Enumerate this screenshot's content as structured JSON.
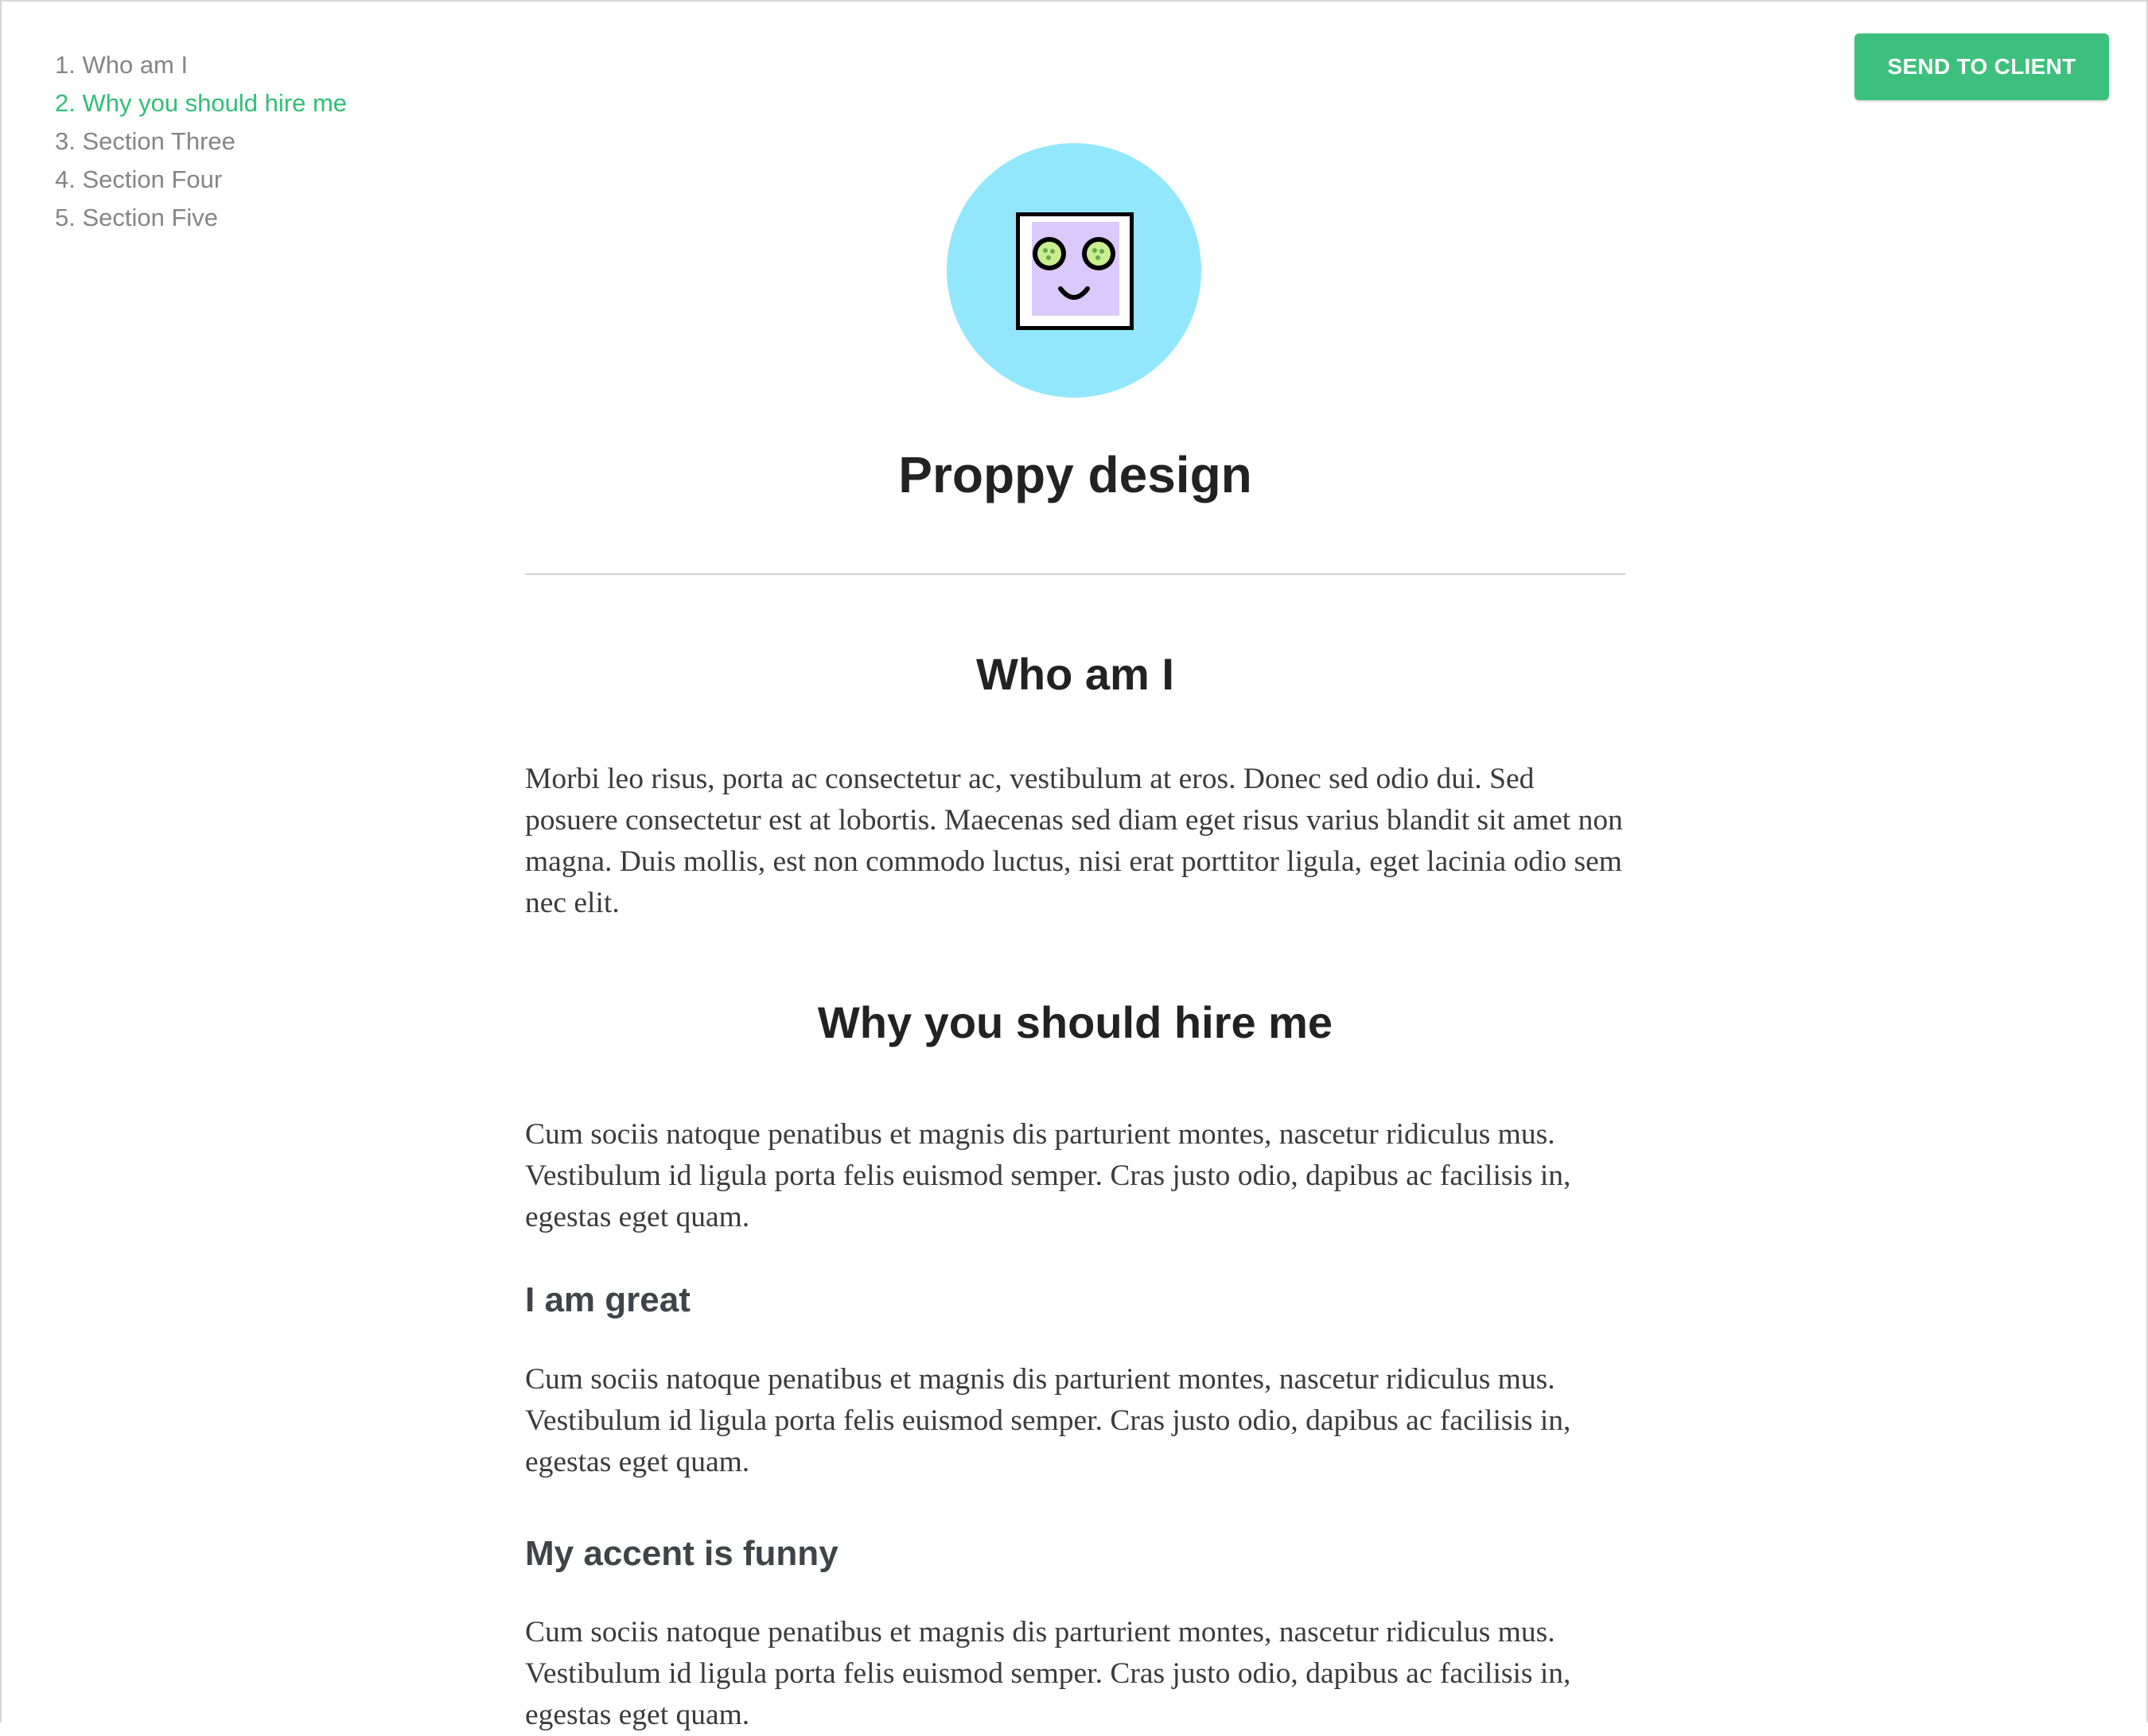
{
  "toc": {
    "items": [
      {
        "label": "1. Who am I"
      },
      {
        "label": "2. Why you should hire me"
      },
      {
        "label": "3. Section Three"
      },
      {
        "label": "4. Section Four"
      },
      {
        "label": "5. Section Five"
      }
    ],
    "active_index": 1,
    "active_color": "#2fbf76"
  },
  "header": {
    "send_button_label": "SEND TO CLIENT",
    "accent_color": "#3ec07d"
  },
  "avatar": {
    "icon": "robot-face-cucumber-eyes-icon",
    "background_color": "#93e7fc"
  },
  "document": {
    "title": "Proppy design",
    "sections": [
      {
        "heading": "Who am I",
        "body": "Morbi leo risus, porta ac consectetur ac, vestibulum at eros. Donec sed odio dui. Sed posuere consectetur est at lobortis. Maecenas sed diam eget risus varius blandit sit amet non magna. Duis mollis, est non commodo luctus, nisi erat porttitor ligula, eget lacinia odio sem nec elit."
      },
      {
        "heading": "Why you should hire me",
        "body": "Cum sociis natoque penatibus et magnis dis parturient montes, nascetur ridiculus mus. Vestibulum id ligula porta felis euismod semper. Cras justo odio, dapibus ac facilisis in, egestas eget quam.",
        "subsections": [
          {
            "heading": "I am great",
            "body": "Cum sociis natoque penatibus et magnis dis parturient montes, nascetur ridiculus mus. Vestibulum id ligula porta felis euismod semper. Cras justo odio, dapibus ac facilisis in, egestas eget quam."
          },
          {
            "heading": "My accent is funny",
            "body": "Cum sociis natoque penatibus et magnis dis parturient montes, nascetur ridiculus mus. Vestibulum id ligula porta felis euismod semper. Cras justo odio, dapibus ac facilisis in, egestas eget quam."
          }
        ]
      }
    ]
  }
}
